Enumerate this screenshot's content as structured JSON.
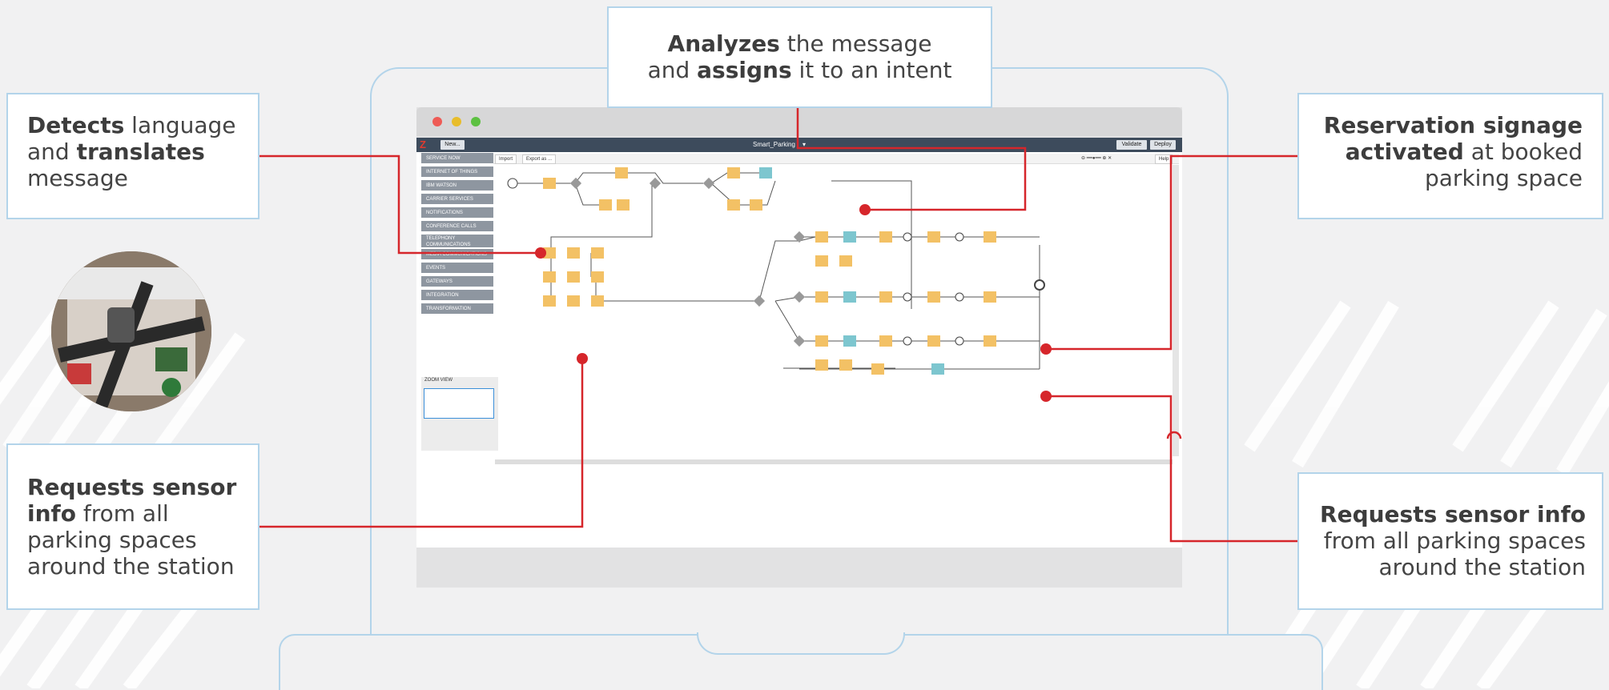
{
  "callouts": {
    "top": {
      "part1_bold": "Analyzes",
      "part2": " the message",
      "part3": "and ",
      "part4_bold": "assigns",
      "part5": " it to an intent"
    },
    "left_top": {
      "part1_bold": "Detects",
      "part2": " language and ",
      "part3_bold": "translates",
      "part4": " message"
    },
    "left_bottom": {
      "part1_bold": "Requests sensor info",
      "part2": " from all parking spaces around the station"
    },
    "right_top": {
      "part1_bold": "Reservation signage activated",
      "part2": " at booked parking space"
    },
    "right_bottom": {
      "part1_bold": "Requests sensor info",
      "part2": " from all parking spaces around the station"
    }
  },
  "app": {
    "title": "Smart_Parking",
    "new_button": "New...",
    "validate_button": "Validate",
    "deploy_button": "Deploy",
    "import_button": "Import",
    "export_button": "Export as ...",
    "help_button": "Help",
    "zoom_view_label": "ZOOM VIEW",
    "palette": [
      "SERVICE NOW",
      "INTERNET OF THINGS",
      "IBM WATSON",
      "CARRIER SERVICES",
      "NOTIFICATIONS",
      "CONFERENCE CALLS",
      "TELEPHONY COMMUNICATIONS",
      "MEDIA COMMUNICATIONS",
      "EVENTS",
      "GATEWAYS",
      "INTEGRATION",
      "TRANSFORMATION"
    ]
  },
  "colors": {
    "accent_red": "#d6262b",
    "callout_border": "#b3d4ea",
    "toolbar": "#3d4b5c",
    "palette_item": "#8e96a0",
    "node_orange": "#f3c165",
    "node_teal": "#7dc6cf"
  }
}
